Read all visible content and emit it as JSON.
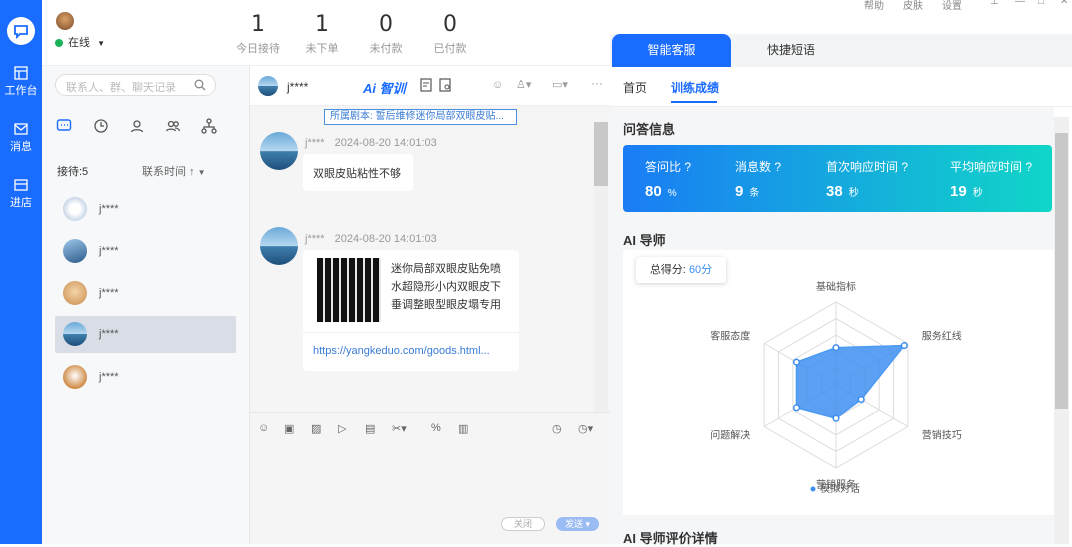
{
  "nav": {
    "items": [
      {
        "label": "工作台"
      },
      {
        "label": "消息"
      },
      {
        "label": "进店"
      }
    ]
  },
  "header": {
    "status": "在线",
    "stats": [
      {
        "value": "1",
        "label": "今日接待"
      },
      {
        "value": "1",
        "label": "未下单"
      },
      {
        "value": "0",
        "label": "未付款"
      },
      {
        "value": "0",
        "label": "已付款"
      }
    ],
    "window_menu": [
      "帮助",
      "皮肤",
      "设置"
    ]
  },
  "sidebar": {
    "search_placeholder": "联系人、群、聊天记录",
    "reception_label": "接待:5",
    "sort_label": "联系时间",
    "contacts": [
      {
        "name": "j****"
      },
      {
        "name": "j****"
      },
      {
        "name": "j****"
      },
      {
        "name": "j****"
      },
      {
        "name": "j****"
      }
    ],
    "selected_index": 3
  },
  "chat": {
    "name": "j****",
    "ai_label": "Ai 智训",
    "script_banner": "所属剧本: 誓后维修迷你局部双眼皮贴...",
    "messages": [
      {
        "sender": "j****",
        "time": "2024-08-20 14:01:03",
        "text": "双眼皮贴粘性不够"
      },
      {
        "sender": "j****",
        "time": "2024-08-20 14:01:03",
        "product_title": "迷你局部双眼皮贴免喷水超隐形小内双眼皮下垂调整眼型眼皮塌专用",
        "link": "https://yangkeduo.com/goods.html..."
      }
    ],
    "close_label": "关闭",
    "send_label": "发送"
  },
  "right": {
    "tabs": [
      {
        "label": "智能客服"
      },
      {
        "label": "快捷短语"
      }
    ],
    "subtabs": [
      {
        "label": "首页"
      },
      {
        "label": "训练成绩"
      }
    ],
    "qa_title": "问答信息",
    "metrics": [
      {
        "label": "答问比",
        "value": "80",
        "unit": "%"
      },
      {
        "label": "消息数",
        "value": "9",
        "unit": "条"
      },
      {
        "label": "首次响应时间",
        "value": "38",
        "unit": "秒"
      },
      {
        "label": "平均响应时间",
        "value": "19",
        "unit": "秒"
      }
    ],
    "mentor_title": "AI 导师",
    "score_label": "总得分:",
    "score_value": "60分",
    "eval_title": "AI 导师评价详情"
  },
  "colors": {
    "brand": "#1a6cff",
    "radar_fill": "#3e8ff0",
    "metric_gradient": [
      "#1a7cf5",
      "#10d6c8"
    ]
  },
  "chart_data": {
    "type": "radar",
    "axes": [
      "基础指标",
      "服务红线",
      "营销技巧",
      "营销服务",
      "问题解决",
      "客服态度"
    ],
    "max": 100,
    "series": [
      {
        "name": "模拟对话",
        "values": [
          45,
          95,
          35,
          40,
          55,
          55
        ]
      }
    ],
    "legend_position": "bottom"
  }
}
